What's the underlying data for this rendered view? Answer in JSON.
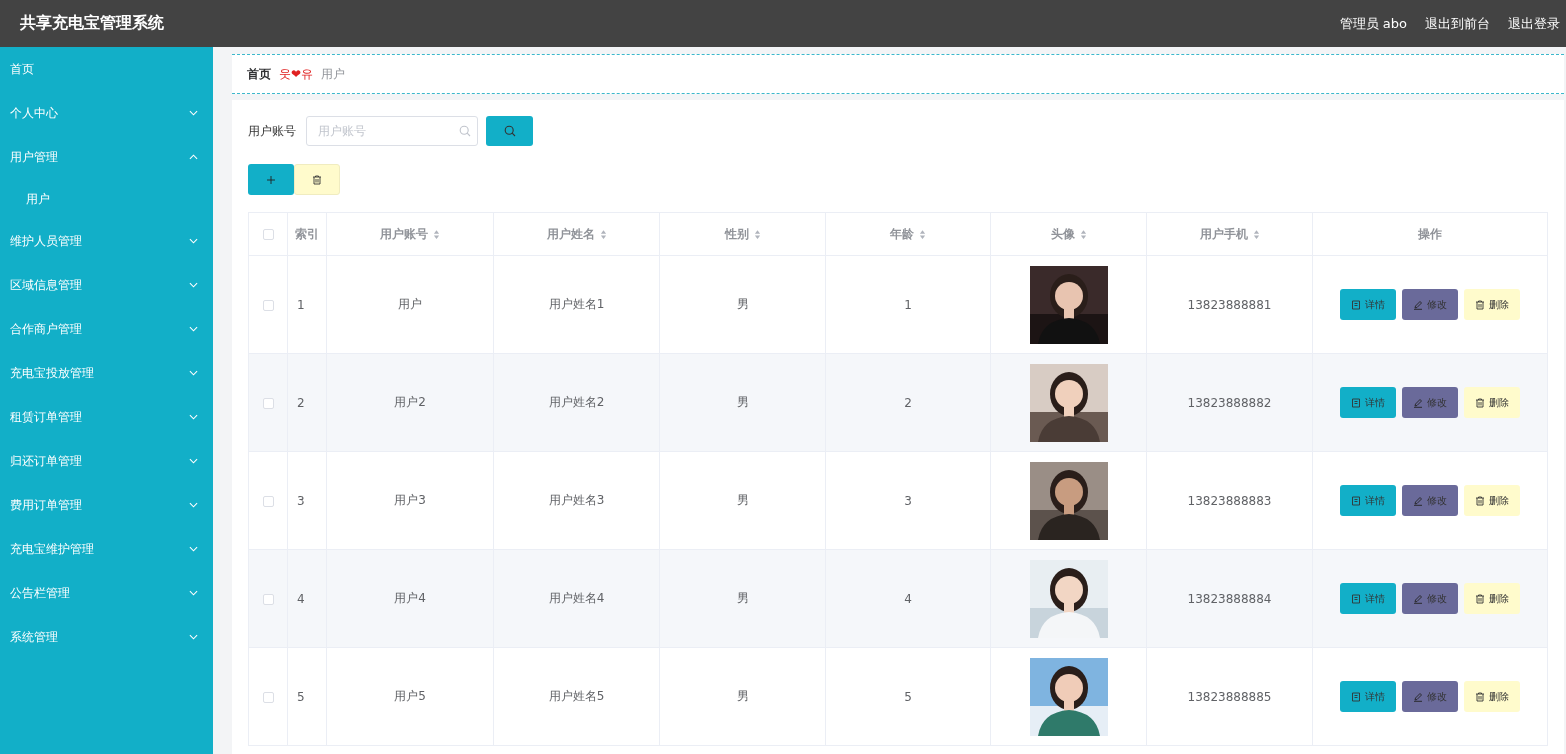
{
  "header": {
    "title": "共享充电宝管理系统",
    "links": [
      "管理员 abo",
      "退出到前台",
      "退出登录"
    ]
  },
  "sidebar": {
    "items": [
      {
        "label": "首页"
      },
      {
        "label": "个人中心",
        "expanded": false
      },
      {
        "label": "用户管理",
        "expanded": true,
        "children": [
          {
            "label": "用户"
          }
        ]
      },
      {
        "label": "维护人员管理",
        "expanded": false
      },
      {
        "label": "区域信息管理",
        "expanded": false
      },
      {
        "label": "合作商户管理",
        "expanded": false
      },
      {
        "label": "充电宝投放管理",
        "expanded": false
      },
      {
        "label": "租赁订单管理",
        "expanded": false
      },
      {
        "label": "归还订单管理",
        "expanded": false
      },
      {
        "label": "费用订单管理",
        "expanded": false
      },
      {
        "label": "充电宝维护管理",
        "expanded": false
      },
      {
        "label": "公告栏管理",
        "expanded": false
      },
      {
        "label": "系统管理",
        "expanded": false
      }
    ]
  },
  "breadcrumb": {
    "home": "首页",
    "separator": "웃❤유",
    "current": "用户"
  },
  "search": {
    "label": "用户账号",
    "placeholder": "用户账号"
  },
  "table": {
    "select_all_checked": false,
    "columns": [
      {
        "label": "索引",
        "sortable": false
      },
      {
        "label": "用户账号",
        "sortable": true
      },
      {
        "label": "用户姓名",
        "sortable": true
      },
      {
        "label": "性别",
        "sortable": true
      },
      {
        "label": "年龄",
        "sortable": true
      },
      {
        "label": "头像",
        "sortable": true
      },
      {
        "label": "用户手机",
        "sortable": true
      },
      {
        "label": "操作",
        "sortable": false
      }
    ],
    "rows": [
      {
        "checked": false,
        "index": "1",
        "account": "用户",
        "name": "用户姓名1",
        "gender": "男",
        "age": "1",
        "phone": "13823888881",
        "actions": [
          {
            "kind": "detail",
            "label": "详情"
          },
          {
            "kind": "edit",
            "label": "修改"
          },
          {
            "kind": "delete",
            "label": "删除"
          }
        ]
      },
      {
        "checked": false,
        "index": "2",
        "account": "用户2",
        "name": "用户姓名2",
        "gender": "男",
        "age": "2",
        "phone": "13823888882",
        "actions": [
          {
            "kind": "detail",
            "label": "详情"
          },
          {
            "kind": "edit",
            "label": "修改"
          },
          {
            "kind": "delete",
            "label": "删除"
          }
        ]
      },
      {
        "checked": false,
        "index": "3",
        "account": "用户3",
        "name": "用户姓名3",
        "gender": "男",
        "age": "3",
        "phone": "13823888883",
        "actions": [
          {
            "kind": "detail",
            "label": "详情"
          },
          {
            "kind": "edit",
            "label": "修改"
          },
          {
            "kind": "delete",
            "label": "删除"
          }
        ]
      },
      {
        "checked": false,
        "index": "4",
        "account": "用户4",
        "name": "用户姓名4",
        "gender": "男",
        "age": "4",
        "phone": "13823888884",
        "actions": [
          {
            "kind": "detail",
            "label": "详情"
          },
          {
            "kind": "edit",
            "label": "修改"
          },
          {
            "kind": "delete",
            "label": "删除"
          }
        ]
      },
      {
        "checked": false,
        "index": "5",
        "account": "用户5",
        "name": "用户姓名5",
        "gender": "男",
        "age": "5",
        "phone": "13823888885",
        "actions": [
          {
            "kind": "detail",
            "label": "详情"
          },
          {
            "kind": "edit",
            "label": "修改"
          },
          {
            "kind": "delete",
            "label": "删除"
          }
        ]
      }
    ]
  }
}
